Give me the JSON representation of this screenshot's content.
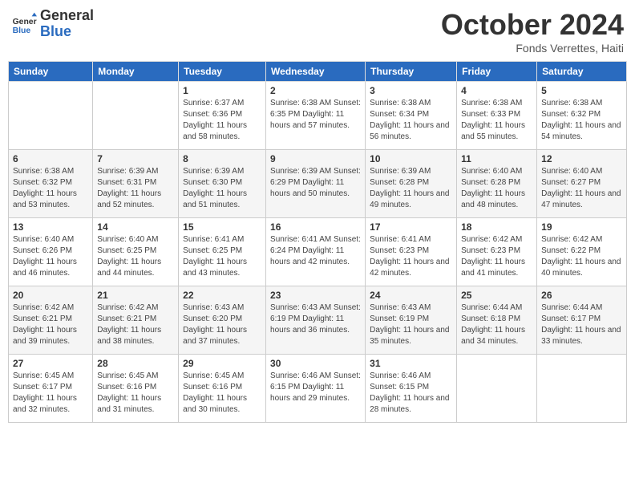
{
  "header": {
    "logo_line1": "General",
    "logo_line2": "Blue",
    "month": "October 2024",
    "location": "Fonds Verrettes, Haiti"
  },
  "weekdays": [
    "Sunday",
    "Monday",
    "Tuesday",
    "Wednesday",
    "Thursday",
    "Friday",
    "Saturday"
  ],
  "weeks": [
    [
      {
        "day": "",
        "info": ""
      },
      {
        "day": "",
        "info": ""
      },
      {
        "day": "1",
        "info": "Sunrise: 6:37 AM\nSunset: 6:36 PM\nDaylight: 11 hours and 58 minutes."
      },
      {
        "day": "2",
        "info": "Sunrise: 6:38 AM\nSunset: 6:35 PM\nDaylight: 11 hours and 57 minutes."
      },
      {
        "day": "3",
        "info": "Sunrise: 6:38 AM\nSunset: 6:34 PM\nDaylight: 11 hours and 56 minutes."
      },
      {
        "day": "4",
        "info": "Sunrise: 6:38 AM\nSunset: 6:33 PM\nDaylight: 11 hours and 55 minutes."
      },
      {
        "day": "5",
        "info": "Sunrise: 6:38 AM\nSunset: 6:32 PM\nDaylight: 11 hours and 54 minutes."
      }
    ],
    [
      {
        "day": "6",
        "info": "Sunrise: 6:38 AM\nSunset: 6:32 PM\nDaylight: 11 hours and 53 minutes."
      },
      {
        "day": "7",
        "info": "Sunrise: 6:39 AM\nSunset: 6:31 PM\nDaylight: 11 hours and 52 minutes."
      },
      {
        "day": "8",
        "info": "Sunrise: 6:39 AM\nSunset: 6:30 PM\nDaylight: 11 hours and 51 minutes."
      },
      {
        "day": "9",
        "info": "Sunrise: 6:39 AM\nSunset: 6:29 PM\nDaylight: 11 hours and 50 minutes."
      },
      {
        "day": "10",
        "info": "Sunrise: 6:39 AM\nSunset: 6:28 PM\nDaylight: 11 hours and 49 minutes."
      },
      {
        "day": "11",
        "info": "Sunrise: 6:40 AM\nSunset: 6:28 PM\nDaylight: 11 hours and 48 minutes."
      },
      {
        "day": "12",
        "info": "Sunrise: 6:40 AM\nSunset: 6:27 PM\nDaylight: 11 hours and 47 minutes."
      }
    ],
    [
      {
        "day": "13",
        "info": "Sunrise: 6:40 AM\nSunset: 6:26 PM\nDaylight: 11 hours and 46 minutes."
      },
      {
        "day": "14",
        "info": "Sunrise: 6:40 AM\nSunset: 6:25 PM\nDaylight: 11 hours and 44 minutes."
      },
      {
        "day": "15",
        "info": "Sunrise: 6:41 AM\nSunset: 6:25 PM\nDaylight: 11 hours and 43 minutes."
      },
      {
        "day": "16",
        "info": "Sunrise: 6:41 AM\nSunset: 6:24 PM\nDaylight: 11 hours and 42 minutes."
      },
      {
        "day": "17",
        "info": "Sunrise: 6:41 AM\nSunset: 6:23 PM\nDaylight: 11 hours and 42 minutes."
      },
      {
        "day": "18",
        "info": "Sunrise: 6:42 AM\nSunset: 6:23 PM\nDaylight: 11 hours and 41 minutes."
      },
      {
        "day": "19",
        "info": "Sunrise: 6:42 AM\nSunset: 6:22 PM\nDaylight: 11 hours and 40 minutes."
      }
    ],
    [
      {
        "day": "20",
        "info": "Sunrise: 6:42 AM\nSunset: 6:21 PM\nDaylight: 11 hours and 39 minutes."
      },
      {
        "day": "21",
        "info": "Sunrise: 6:42 AM\nSunset: 6:21 PM\nDaylight: 11 hours and 38 minutes."
      },
      {
        "day": "22",
        "info": "Sunrise: 6:43 AM\nSunset: 6:20 PM\nDaylight: 11 hours and 37 minutes."
      },
      {
        "day": "23",
        "info": "Sunrise: 6:43 AM\nSunset: 6:19 PM\nDaylight: 11 hours and 36 minutes."
      },
      {
        "day": "24",
        "info": "Sunrise: 6:43 AM\nSunset: 6:19 PM\nDaylight: 11 hours and 35 minutes."
      },
      {
        "day": "25",
        "info": "Sunrise: 6:44 AM\nSunset: 6:18 PM\nDaylight: 11 hours and 34 minutes."
      },
      {
        "day": "26",
        "info": "Sunrise: 6:44 AM\nSunset: 6:17 PM\nDaylight: 11 hours and 33 minutes."
      }
    ],
    [
      {
        "day": "27",
        "info": "Sunrise: 6:45 AM\nSunset: 6:17 PM\nDaylight: 11 hours and 32 minutes."
      },
      {
        "day": "28",
        "info": "Sunrise: 6:45 AM\nSunset: 6:16 PM\nDaylight: 11 hours and 31 minutes."
      },
      {
        "day": "29",
        "info": "Sunrise: 6:45 AM\nSunset: 6:16 PM\nDaylight: 11 hours and 30 minutes."
      },
      {
        "day": "30",
        "info": "Sunrise: 6:46 AM\nSunset: 6:15 PM\nDaylight: 11 hours and 29 minutes."
      },
      {
        "day": "31",
        "info": "Sunrise: 6:46 AM\nSunset: 6:15 PM\nDaylight: 11 hours and 28 minutes."
      },
      {
        "day": "",
        "info": ""
      },
      {
        "day": "",
        "info": ""
      }
    ]
  ]
}
